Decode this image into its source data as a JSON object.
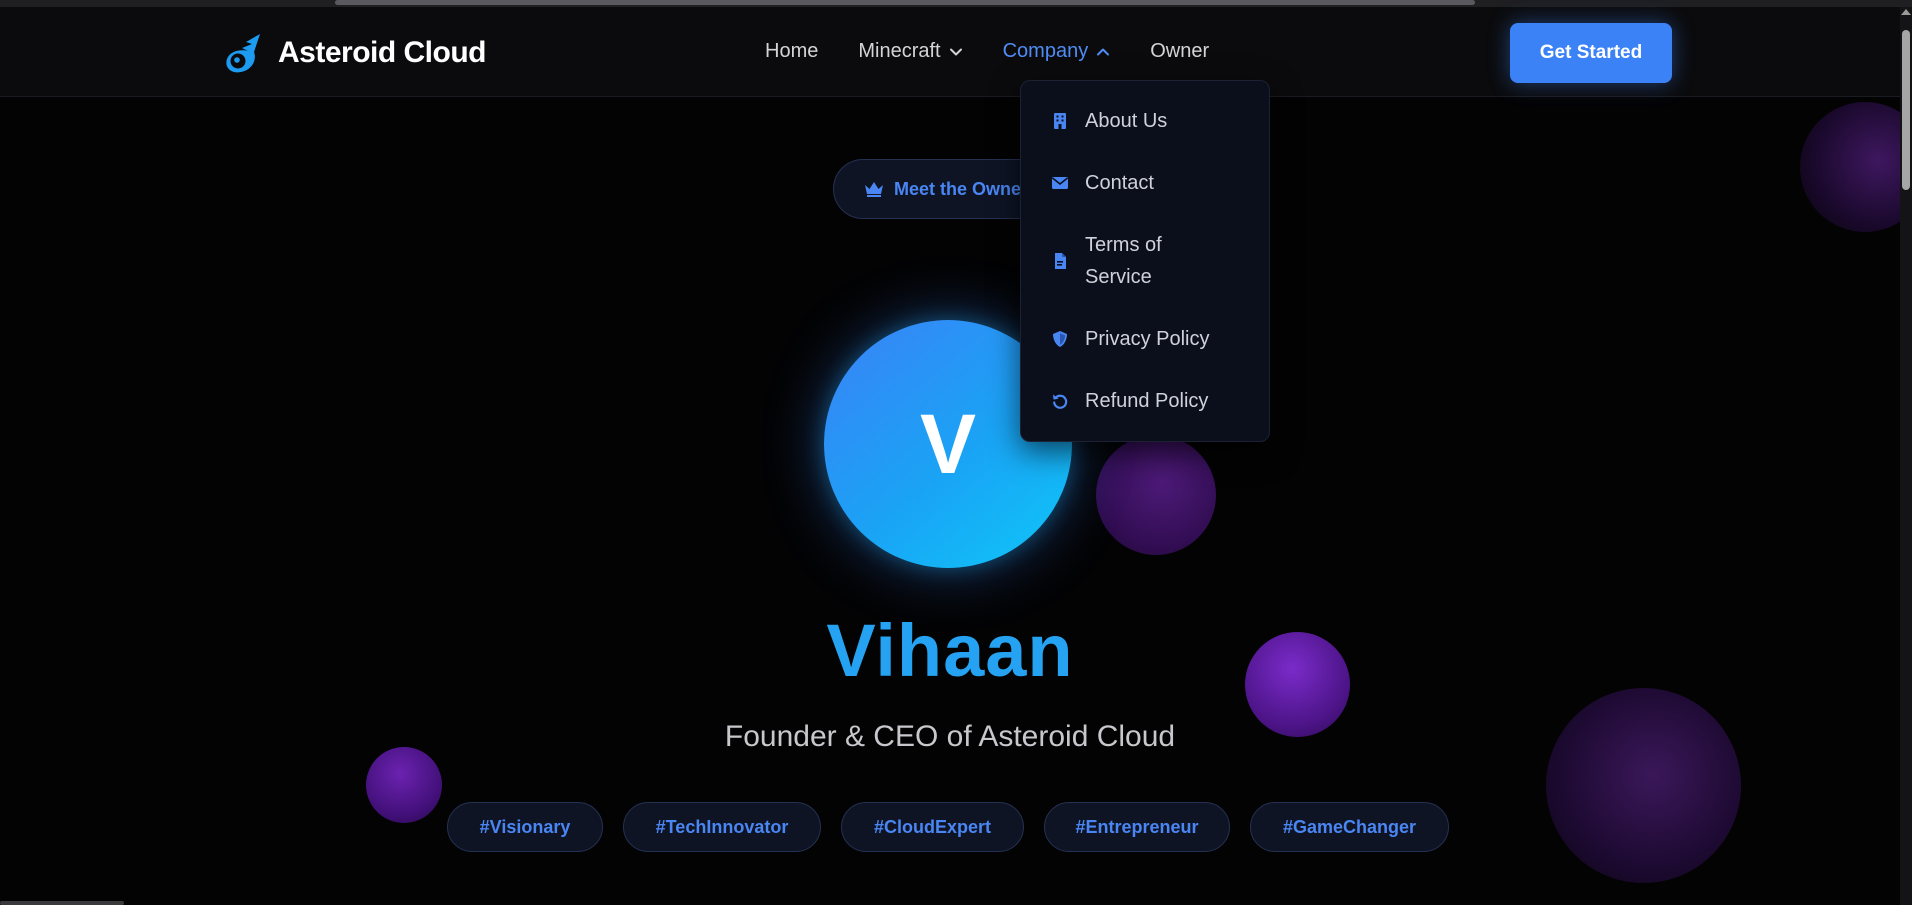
{
  "brand": {
    "name": "Asteroid Cloud",
    "logo_icon": "comet-logo-icon"
  },
  "nav": {
    "items": [
      {
        "label": "Home",
        "has_chevron": false
      },
      {
        "label": "Minecraft",
        "has_chevron": true,
        "chevron": "chevron-down"
      },
      {
        "label": "Company",
        "has_chevron": true,
        "chevron": "chevron-up",
        "active": true
      },
      {
        "label": "Owner",
        "has_chevron": false
      }
    ],
    "cta_label": "Get Started"
  },
  "company_menu": {
    "items": [
      {
        "label": "About Us",
        "icon": "building-icon"
      },
      {
        "label": "Contact",
        "icon": "envelope-icon"
      },
      {
        "label": "Terms of Service",
        "icon": "document-icon"
      },
      {
        "label": "Privacy Policy",
        "icon": "shield-icon"
      },
      {
        "label": "Refund Policy",
        "icon": "undo-icon"
      }
    ]
  },
  "hero": {
    "badge_label": "Meet the Owner",
    "badge_icon": "crown-icon",
    "avatar_initial": "V",
    "name": "Vihaan",
    "role": "Founder & CEO of Asteroid Cloud",
    "tags": [
      "#Visionary",
      "#TechInnovator",
      "#CloudExpert",
      "#Entrepreneur",
      "#GameChanger"
    ]
  },
  "colors": {
    "accent": "#3b82f6",
    "name_color": "#25a3f2",
    "background": "#030304",
    "orb": "#6b21a8"
  }
}
